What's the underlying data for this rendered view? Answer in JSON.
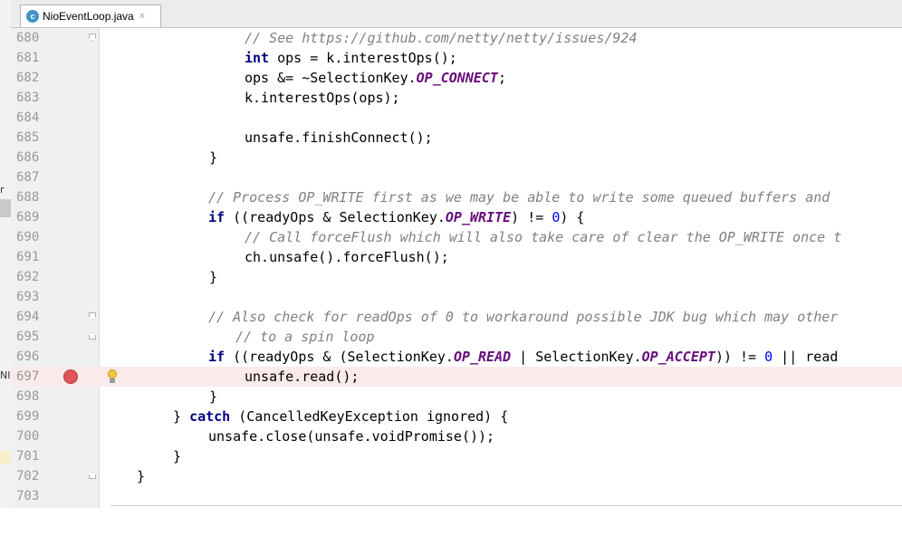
{
  "tab": {
    "icon_letter": "c",
    "filename": "NioEventLoop.java",
    "close": "×"
  },
  "side_fragments": [
    "r",
    "NI"
  ],
  "lines": {
    "680": "680",
    "681": "681",
    "682": "682",
    "683": "683",
    "684": "684",
    "685": "685",
    "686": "686",
    "687": "687",
    "688": "688",
    "689": "689",
    "690": "690",
    "691": "691",
    "692": "692",
    "693": "693",
    "694": "694",
    "695": "695",
    "696": "696",
    "697": "697",
    "698": "698",
    "699": "699",
    "700": "700",
    "701": "701",
    "702": "702",
    "703": "703"
  },
  "code": {
    "l680_cm": "// See https://github.com/netty/netty/issues/924",
    "l681_kw": "int",
    "l681_rest": " ops = k.interestOps();",
    "l682_a": "ops &= ~SelectionKey.",
    "l682_f": "OP_CONNECT",
    "l682_b": ";",
    "l683": "k.interestOps(ops);",
    "l685": "unsafe.finishConnect();",
    "l686": "}",
    "l688_cm": "// Process OP_WRITE first as we may be able to write some queued buffers and",
    "l689_kw": "if",
    "l689_a": " ((readyOps & SelectionKey.",
    "l689_f": "OP_WRITE",
    "l689_b": ") != ",
    "l689_n": "0",
    "l689_c": ") {",
    "l690_cm": "// Call forceFlush which will also take care of clear the OP_WRITE once t",
    "l691": "ch.unsafe().forceFlush();",
    "l692": "}",
    "l694_cm": "// Also check for readOps of 0 to workaround possible JDK bug which may other",
    "l695_cm": "// to a spin loop",
    "l696_kw": "if",
    "l696_a": " ((readyOps & (SelectionKey.",
    "l696_f1": "OP_READ",
    "l696_b": " | SelectionKey.",
    "l696_f2": "OP_ACCEPT",
    "l696_c": ")) != ",
    "l696_n": "0",
    "l696_d": " || read",
    "l697": "unsafe.read();",
    "l698": "}",
    "l699_a": "} ",
    "l699_kw": "catch",
    "l699_b": " (CancelledKeyException ignored) {",
    "l700": "unsafe.close(unsafe.voidPromise());",
    "l701": "}",
    "l702": "}"
  },
  "colors": {
    "keyword": "#000080",
    "comment": "#808080",
    "constant": "#660e7a",
    "number": "#0000ff",
    "highlight_line": "#faeaea",
    "breakpoint": "#e05555"
  },
  "icons": {
    "breakpoint": "breakpoint-icon",
    "intention": "lightbulb-icon",
    "fold": "fold-marker-icon"
  }
}
